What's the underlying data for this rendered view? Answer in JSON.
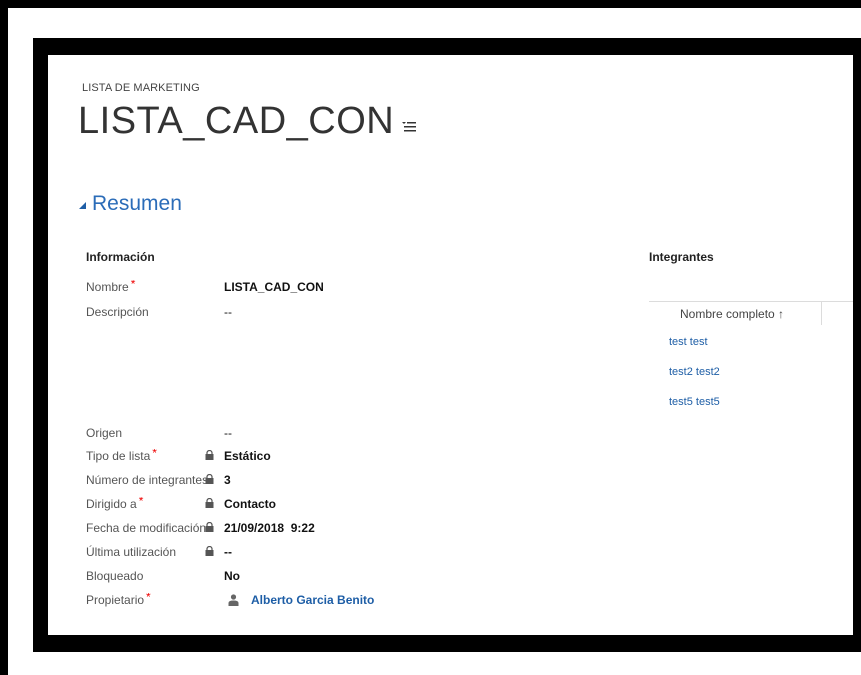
{
  "header": {
    "entity_type": "LISTA DE MARKETING",
    "title": "LISTA_CAD_CON"
  },
  "section": {
    "title": "Resumen"
  },
  "info": {
    "heading": "Información",
    "fields": [
      {
        "label": "Nombre",
        "required": "*",
        "value": "LISTA_CAD_CON"
      },
      {
        "label": "Descripción",
        "value": "--"
      },
      {
        "label": "Origen",
        "value": "--"
      },
      {
        "label": "Tipo de lista",
        "required": "*",
        "value": "Estático"
      },
      {
        "label": "Número de integrantes",
        "value": "3"
      },
      {
        "label": "Dirigido a",
        "required": "*",
        "value": "Contacto"
      },
      {
        "label": "Fecha de modificación",
        "value": "21/09/2018  9:22"
      },
      {
        "label": "Última utilización",
        "value": "--"
      },
      {
        "label": "Bloqueado",
        "value": "No"
      },
      {
        "label": "Propietario",
        "required": "*",
        "value": "Alberto Garcia Benito"
      }
    ]
  },
  "members": {
    "heading": "Integrantes",
    "column_header": "Nombre completo ↑",
    "rows": [
      "test test",
      "test2 test2",
      "test5 test5"
    ]
  },
  "icons": {
    "lock": "lock-icon",
    "owner": "user-icon",
    "menu": "list-menu-icon"
  }
}
